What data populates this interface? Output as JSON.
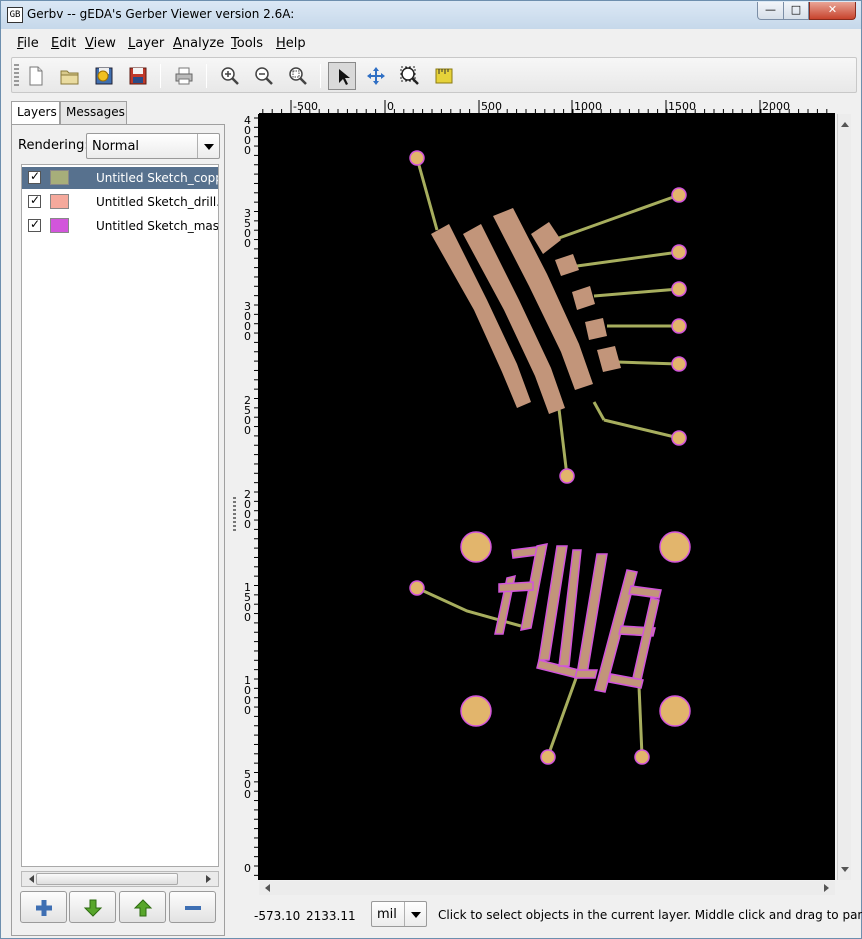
{
  "window": {
    "title": "Gerbv -- gEDA's Gerber Viewer version 2.6A:",
    "app_icon_text": "GB",
    "min_glyph": "—",
    "max_glyph": "□",
    "close_glyph": "✕"
  },
  "menu": [
    "File",
    "Edit",
    "View",
    "Layer",
    "Analyze",
    "Tools",
    "Help"
  ],
  "toolbar": {
    "buttons": [
      {
        "name": "new-project-icon"
      },
      {
        "name": "open-project-icon"
      },
      {
        "name": "revert-icon"
      },
      {
        "name": "save-icon"
      },
      {
        "name": "print-icon"
      },
      {
        "name": "zoom-in-icon"
      },
      {
        "name": "zoom-out-icon"
      },
      {
        "name": "zoom-fit-icon"
      },
      {
        "name": "pointer-tool-icon"
      },
      {
        "name": "pan-tool-icon"
      },
      {
        "name": "zoom-tool-icon"
      },
      {
        "name": "measure-tool-icon"
      }
    ],
    "active_tool": "pointer-tool-icon"
  },
  "left_panel": {
    "tabs": [
      "Layers",
      "Messages"
    ],
    "active_tab": "Layers",
    "rendering_label": "Rendering:",
    "rendering_value": "Normal",
    "layers": [
      {
        "name": "Untitled Sketch_copper",
        "color": "#a7ae7a",
        "checked": true,
        "selected": true
      },
      {
        "name": "Untitled Sketch_drill.txt",
        "color": "#f5a99c",
        "checked": true,
        "selected": false
      },
      {
        "name": "Untitled Sketch_mask",
        "color": "#d255db",
        "checked": true,
        "selected": false
      }
    ],
    "buttons": [
      {
        "name": "add-layer-icon",
        "color": "#3e6fb3"
      },
      {
        "name": "move-layer-down-icon",
        "color": "#58a62b"
      },
      {
        "name": "move-layer-up-icon",
        "color": "#58a62b"
      },
      {
        "name": "remove-layer-icon",
        "color": "#3e6fb3"
      }
    ]
  },
  "ruler": {
    "top_labels": [
      "-500",
      "0",
      "500",
      "1000",
      "1500",
      "2000"
    ],
    "left_labels": [
      "4000",
      "3500",
      "3000",
      "2500",
      "2000",
      "1500",
      "1000",
      "500",
      "0"
    ]
  },
  "canvas": {
    "background": "#000000",
    "copper_color": "#a7ae5e",
    "pad_color": "#c2957a",
    "mask_color": "#d255db",
    "drill_color": "#e2b56c"
  },
  "status": {
    "x_coord": "-573.10",
    "y_coord": "2133.11",
    "unit": "mil",
    "message": "Click to select objects in the current layer. Middle click and drag to pan."
  }
}
